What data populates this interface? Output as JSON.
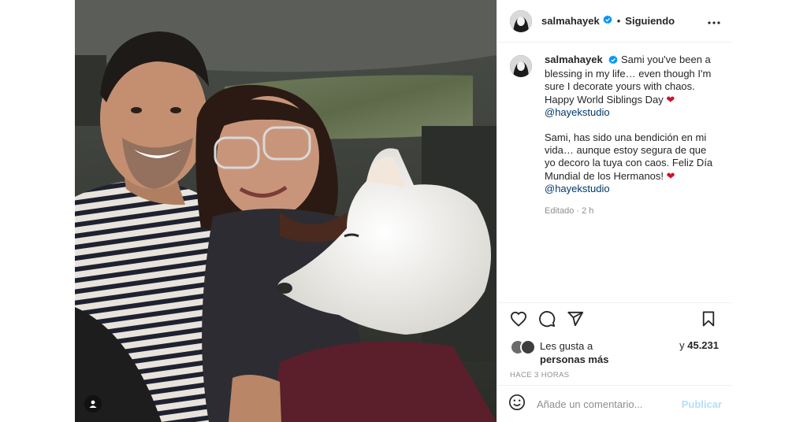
{
  "post": {
    "image_alt": "Photo of Salma Hayek with her brother Sami and a white dog in a car",
    "header": {
      "username": "salmahayek",
      "separator": "•",
      "follow_status": "Siguiendo"
    },
    "caption": {
      "username": "salmahayek",
      "text_en": "Sami you've been a blessing in my life… even though I'm sure I decorate yours with chaos. Happy World Siblings Day",
      "mention_1": "@hayekstudio",
      "text_es": "Sami, has sido una bendición en mi vida… aunque estoy segura de que yo decoro la tuya con caos. Feliz Día Mundial de los Hermanos!",
      "mention_2": "@hayekstudio",
      "heart": "❤",
      "edited": "Editado · 2 h"
    },
    "likes": {
      "prefix": "Les gusta a",
      "suffix": "personas más",
      "joiner": "y",
      "count": "45.231"
    },
    "timestamp": "HACE 3 HORAS",
    "comment": {
      "placeholder": "Añade un comentario...",
      "publish_label": "Publicar"
    }
  },
  "icons": {
    "verified": "verified-badge-icon",
    "more": "more-options-icon",
    "like": "heart-icon",
    "comment": "comment-bubble-icon",
    "share": "paper-plane-icon",
    "save": "bookmark-icon",
    "emoji": "smiley-icon",
    "tag": "user-tag-icon"
  },
  "colors": {
    "verified": "#0095f6",
    "heart": "#d10f2a",
    "mention": "#00376b",
    "publish_disabled": "#b2dffc",
    "muted": "#8e8e8e"
  }
}
